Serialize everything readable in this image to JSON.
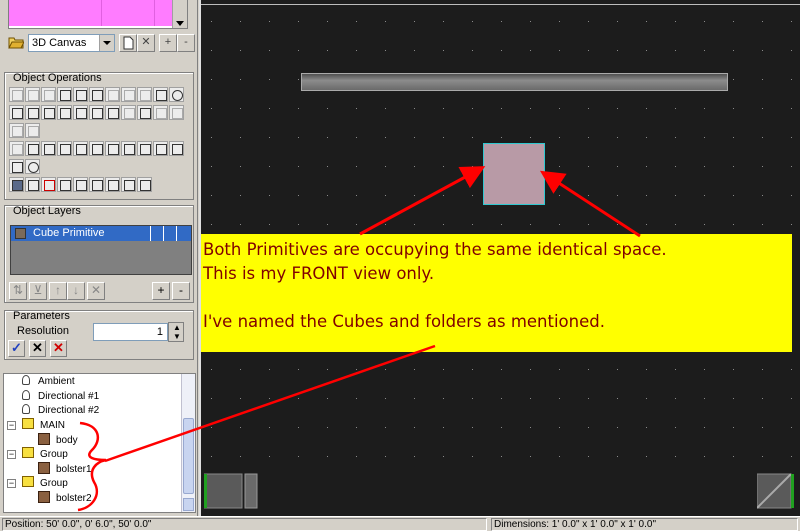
{
  "canvas": {
    "selected": "3D Canvas"
  },
  "object_operations": {
    "title": "Object Operations"
  },
  "object_layers": {
    "title": "Object Layers",
    "items": [
      {
        "label": "Cube Primitive",
        "selected": true
      }
    ],
    "add_label": "+",
    "remove_label": "-"
  },
  "parameters": {
    "title": "Parameters",
    "resolution_label": "Resolution",
    "resolution_value": "1"
  },
  "tree": {
    "items": [
      {
        "label": "Ambient",
        "icon": "light-bulb-icon"
      },
      {
        "label": "Directional #1",
        "icon": "light-bulb-icon"
      },
      {
        "label": "Directional #2",
        "icon": "light-bulb-icon"
      },
      {
        "label": "MAIN",
        "icon": "folder-icon",
        "expanded": true
      },
      {
        "label": "body",
        "icon": "cube-icon"
      },
      {
        "label": "Group",
        "icon": "folder-icon",
        "expanded": true
      },
      {
        "label": "bolster1",
        "icon": "cube-icon"
      },
      {
        "label": "Group",
        "icon": "folder-icon",
        "expanded": true
      },
      {
        "label": "bolster2",
        "icon": "cube-icon"
      }
    ]
  },
  "annotation": {
    "line1": "Both Primitives are occupying the same identical space.",
    "line2": "This is my FRONT view only.",
    "line3": "I've named the Cubes and folders as mentioned.",
    "background_color": "#ffff00",
    "text_color": "#800000",
    "arrow_color": "#ff0000"
  },
  "status": {
    "position": "Position: 50' 0.0\", 0' 6.0\", 50' 0.0\"",
    "dimensions": "Dimensions: 1' 0.0\" x 1' 0.0\" x 1' 0.0\""
  },
  "colors": {
    "preview_pink": "#ff7cff",
    "viewport_bg": "#1c1c1c",
    "cube_face": "#b89aa6",
    "cube_edge": "#30c8d0",
    "selection": "#316ac5"
  }
}
